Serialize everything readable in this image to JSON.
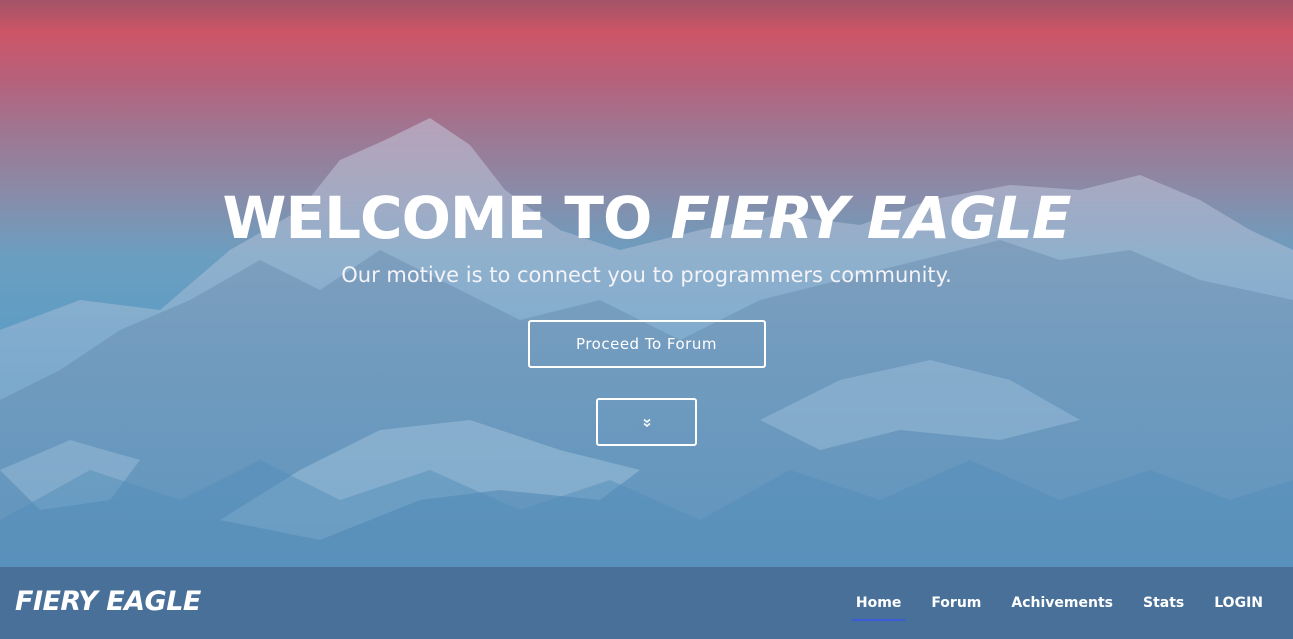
{
  "hero": {
    "title_prefix": "WELCOME TO ",
    "title_brand": "FIERY EAGLE",
    "subtitle": "Our motive is to connect you to programmers community.",
    "cta_label": "Proceed To Forum",
    "scroll_icon": "chevrons-down-icon"
  },
  "navbar": {
    "brand": "FIERY EAGLE",
    "links": [
      {
        "label": "Home",
        "active": true
      },
      {
        "label": "Forum",
        "active": false
      },
      {
        "label": "Achivements",
        "active": false
      },
      {
        "label": "Stats",
        "active": false
      },
      {
        "label": "LOGIN",
        "active": false
      }
    ]
  },
  "colors": {
    "sky_top": "#cc5566",
    "sky_bottom": "#5b98c2",
    "navbar_bg": "#42648c",
    "active_underline": "#3d5bd8",
    "text": "#ffffff"
  }
}
